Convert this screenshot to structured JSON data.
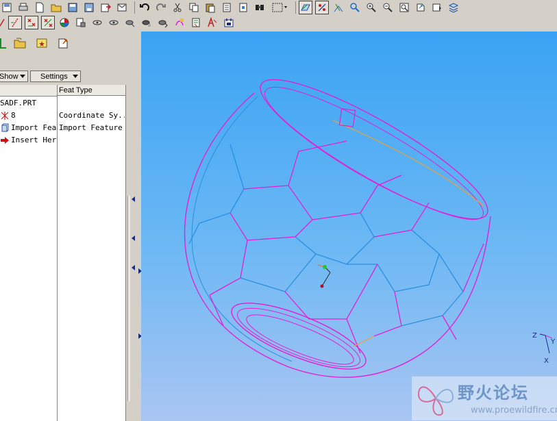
{
  "toolbar": {
    "row1_icons": [
      "save-icon",
      "print-icon",
      "new-file-icon",
      "open-folder-icon",
      "save-copy-icon",
      "backup-icon",
      "export-icon",
      "send-icon",
      "undo-icon",
      "redo-icon",
      "cut-icon",
      "copy-icon",
      "paste-icon",
      "paste-special-icon",
      "regenerate-icon",
      "find-icon",
      "select-box-icon",
      "datum-plane-toggle-icon",
      "datum-axis-toggle-icon",
      "datum-point-toggle-icon",
      "csys-toggle-icon",
      "zoom-in-icon",
      "zoom-out-icon",
      "refit-icon",
      "orient-icon",
      "saved-views-icon",
      "layers-icon"
    ],
    "row2_icons": [
      "sketch-icon",
      "datum-axis-display-icon",
      "datum-point-display-icon",
      "csys-display-icon",
      "appearance-icon",
      "model-display-icon",
      "wireframe-icon",
      "hidden-line-icon",
      "no-hidden-icon",
      "shading-icon",
      "shading-edges-icon",
      "sketch-tool-icon",
      "sketch-tool-alt-icon",
      "annotation-icon",
      "datum-tool-icon"
    ],
    "colors": {
      "accent": "#1a8a2a",
      "pressed": "#404040"
    }
  },
  "left_panel": {
    "tabs": [
      "model-tree-tab-icon",
      "folder-browser-tab-icon",
      "favorites-tab-icon"
    ],
    "show_label": "Show",
    "settings_label": "Settings",
    "columns": {
      "name": "",
      "type": "Feat Type"
    },
    "rows": [
      {
        "name": "SADF.PRT",
        "type": "",
        "icon": ""
      },
      {
        "name": "8",
        "type": "Coordinate Sy...",
        "icon": "csys-icon"
      },
      {
        "name": "Import Fea",
        "type": "Import Feature",
        "icon": "import-feature-icon"
      },
      {
        "name": "Insert Her",
        "type": "",
        "icon": "insert-here-icon"
      }
    ]
  },
  "viewport": {
    "background_top": "#39a3f3",
    "background_bottom": "#a9c5f2",
    "model_color": "#e31fd6",
    "edge_color": "#2a8fe0",
    "triad_labels": {
      "z": "Z",
      "y": "Y",
      "x": "X"
    }
  },
  "watermark": {
    "title": "野火论坛",
    "url": "www.proewildfire.cn"
  }
}
